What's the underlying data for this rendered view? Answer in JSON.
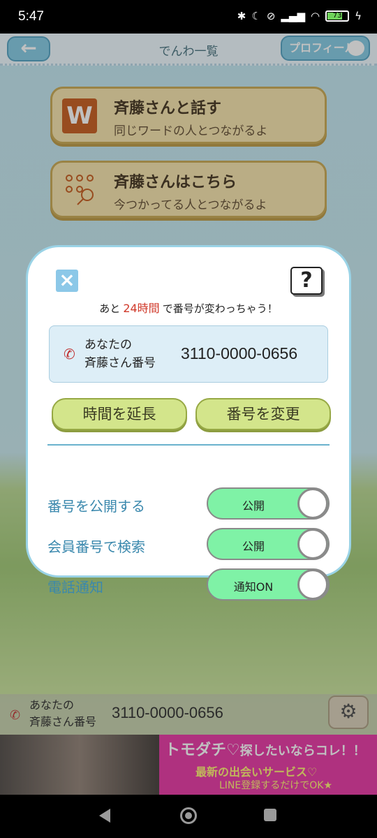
{
  "status_bar": {
    "time": "5:47",
    "battery": "73"
  },
  "header": {
    "back_label": "←",
    "title": "でんわ一覧",
    "profile_label": "プロフィール"
  },
  "menu": [
    {
      "icon": "W",
      "title": "斉藤さんと話す",
      "subtitle": "同じワードの人とつながるよ"
    },
    {
      "title": "斉藤さんはこちら",
      "subtitle": "今つかってる人とつながるよ"
    }
  ],
  "modal": {
    "remain_prefix": "あと",
    "remain_highlight": "24時間",
    "remain_suffix": "で番号が変わっちゃう！",
    "help_label": "?",
    "number_label_line1": "あなたの",
    "number_label_line2": "斉藤さん番号",
    "number": "3110-0000-0656",
    "extend_button": "時間を延長",
    "change_button": "番号を変更",
    "settings": [
      {
        "label": "番号を公開する",
        "toggle": "公開"
      },
      {
        "label": "会員番号で検索",
        "toggle": "公開"
      },
      {
        "label": "電話通知",
        "toggle": "通知ON"
      }
    ]
  },
  "bottom": {
    "label_line1": "あなたの",
    "label_line2": "斉藤さん番号",
    "number": "3110-0000-0656"
  },
  "ad": {
    "line1": "トモダチ♡",
    "line1b": "探したいならコレ！！",
    "line2": "最新の出会いサービス♡",
    "line3": "LINE登録するだけでOK★"
  },
  "colors": {
    "accent": "#7ec9e3",
    "toggle_on": "#7ff2a6",
    "highlight": "#d0392a"
  }
}
